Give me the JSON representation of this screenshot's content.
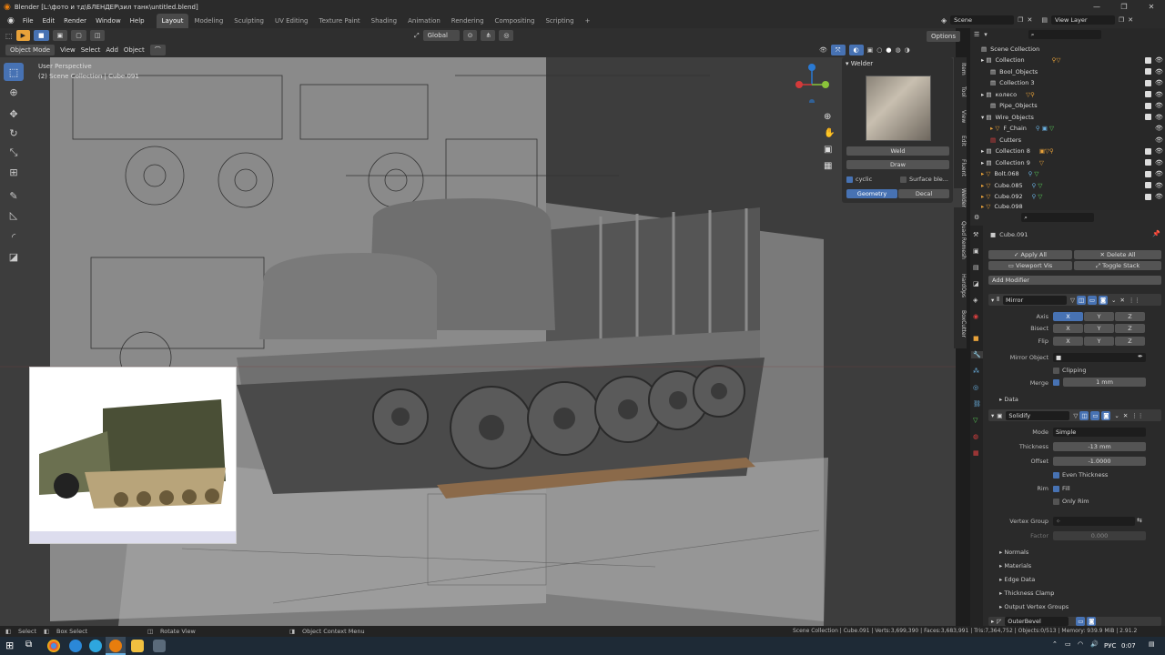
{
  "title": "Blender [L:\\фото и тд\\БЛЕНДЕР\\зил танк\\untitled.blend]",
  "menu": [
    "File",
    "Edit",
    "Render",
    "Window",
    "Help"
  ],
  "workspaces": [
    "Layout",
    "Modeling",
    "Sculpting",
    "UV Editing",
    "Texture Paint",
    "Shading",
    "Animation",
    "Rendering",
    "Compositing",
    "Scripting"
  ],
  "active_workspace": "Layout",
  "scene": "Scene",
  "view_layer": "View Layer",
  "header": {
    "mode": "Object Mode",
    "view": "View",
    "select": "Select",
    "add": "Add",
    "object": "Object",
    "orientation": "Global",
    "options": "Options"
  },
  "viewport": {
    "perspective": "User Perspective",
    "collection": "(2) Scene Collection | Cube.091"
  },
  "welder": {
    "title": "Welder",
    "weld": "Weld",
    "draw": "Draw",
    "cyclic": "cyclic",
    "surface": "Surface ble...",
    "geometry": "Geometry",
    "decal": "Decal"
  },
  "side_tabs": [
    "Item",
    "Tool",
    "View",
    "Edit",
    "Fluent",
    "Welder",
    "Quad Remesh",
    "HardOps",
    "BoxCutter"
  ],
  "outliner": {
    "root": "Scene Collection",
    "rows": [
      "Collection",
      "Bool_Objects",
      "Collection 3",
      "колесо",
      "Pipe_Objects",
      "Wire_Objects",
      "F_Chain",
      "Cutters",
      "Collection 8",
      "Collection 9",
      "Bolt.068",
      "Cube.085",
      "Cube.092",
      "Cube.098"
    ]
  },
  "props": {
    "object": "Cube.091",
    "apply_all": "Apply All",
    "delete_all": "Delete All",
    "viewport_vis": "Viewport Vis",
    "toggle_stack": "Toggle Stack",
    "add_modifier": "Add Modifier",
    "mirror": {
      "name": "Mirror",
      "axis": "Axis",
      "bisect": "Bisect",
      "flip": "Flip",
      "x": "X",
      "y": "Y",
      "z": "Z",
      "mirror_object": "Mirror Object",
      "clipping": "Clipping",
      "merge": "Merge",
      "merge_val": "1 mm",
      "data": "Data"
    },
    "solidify": {
      "name": "Solidify",
      "mode": "Mode",
      "mode_val": "Simple",
      "thickness": "Thickness",
      "thickness_val": "-13 mm",
      "offset": "Offset",
      "offset_val": "-1.0000",
      "even": "Even Thickness",
      "rim": "Rim",
      "fill": "Fill",
      "only_rim": "Only Rim",
      "vgroup": "Vertex Group",
      "factor": "Factor",
      "factor_val": "0.000",
      "subpanels": [
        "Normals",
        "Materials",
        "Edge Data",
        "Thickness Clamp",
        "Output Vertex Groups"
      ]
    },
    "outer_bevel": "OuterBevel"
  },
  "status": {
    "select": "Select",
    "box_select": "Box Select",
    "rotate": "Rotate View",
    "context": "Object Context Menu",
    "stats": "Scene Collection | Cube.091 | Verts:3,699,390 | Faces:3,683,991 | Tris:7,364,752 | Objects:0/513 | Memory: 939.9 MiB | 2.91.2"
  },
  "taskbar": {
    "lang": "РУС",
    "time": "0:07"
  }
}
